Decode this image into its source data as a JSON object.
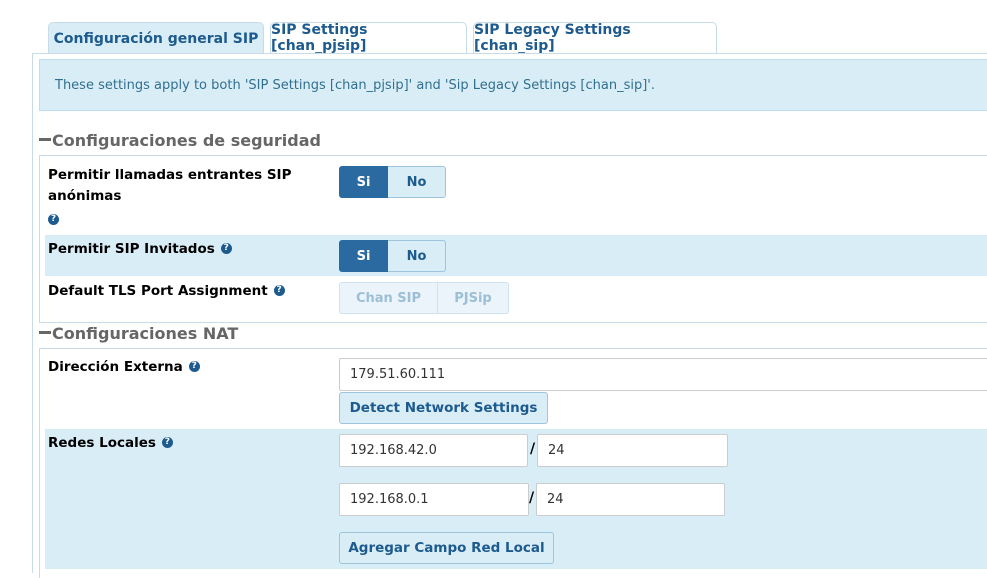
{
  "tabs": [
    {
      "label": "Configuración general SIP",
      "active": true
    },
    {
      "label": "SIP Settings [chan_pjsip]",
      "active": false
    },
    {
      "label": "SIP Legacy Settings [chan_sip]",
      "active": false
    }
  ],
  "info": {
    "text": "These settings apply to both 'SIP Settings [chan_pjsip]' and 'Sip Legacy Settings [chan_sip]'."
  },
  "security": {
    "title": "Configuraciones de seguridad",
    "anonymous": {
      "label": "Permitir llamadas entrantes SIP anónimas",
      "yes": "Si",
      "no": "No",
      "selected": "Si"
    },
    "guests": {
      "label": "Permitir SIP Invitados",
      "yes": "Si",
      "no": "No",
      "selected": "Si"
    },
    "tls": {
      "label": "Default TLS Port Assignment",
      "option1": "Chan SIP",
      "option2": "PJSip"
    }
  },
  "nat": {
    "title": "Configuraciones NAT",
    "external": {
      "label": "Dirección Externa",
      "value": "179.51.60.111",
      "detect_button": "Detect Network Settings"
    },
    "local_networks": {
      "label": "Redes Locales",
      "rows": [
        {
          "network": "192.168.42.0",
          "mask": "24"
        },
        {
          "network": "192.168.0.1",
          "mask": "24"
        }
      ],
      "add_button": "Agregar Campo Red Local"
    }
  },
  "help_icon": "question-circle-icon",
  "colors": {
    "accent": "#2b6aa0",
    "info_bg": "#d9edf7",
    "link": "#1d5a8e"
  }
}
